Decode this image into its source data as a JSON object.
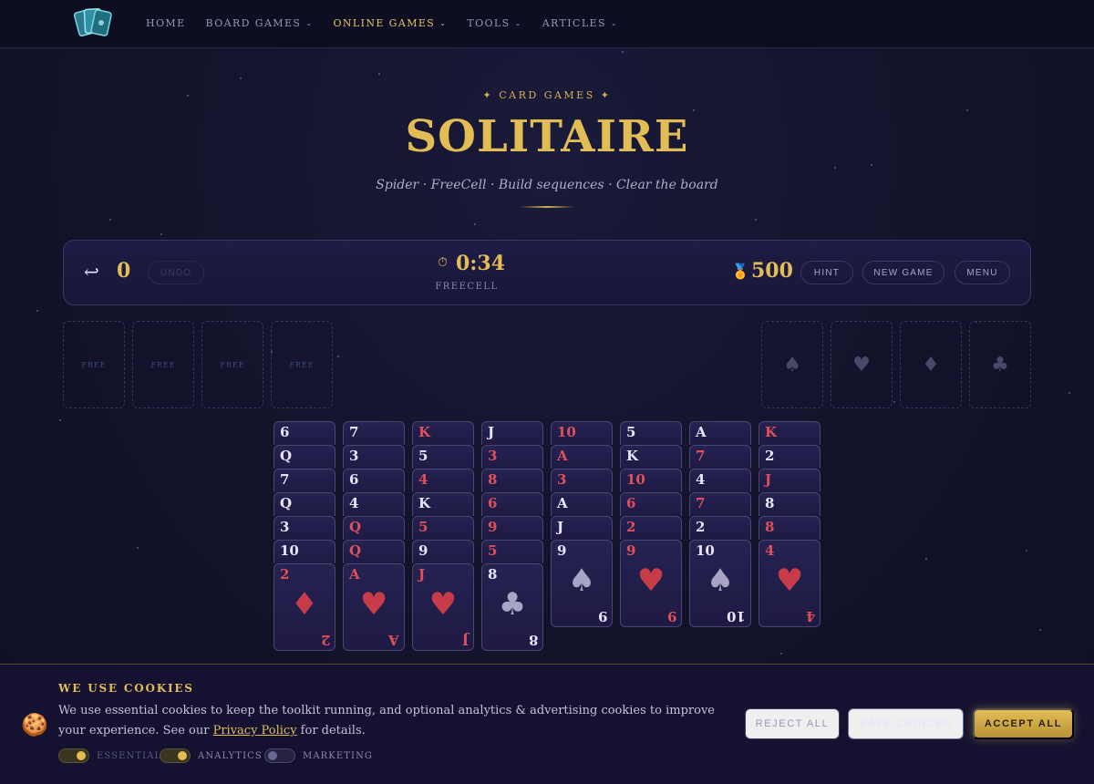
{
  "nav": {
    "items": [
      {
        "label": "HOME",
        "dropdown": false,
        "active": false
      },
      {
        "label": "BOARD GAMES",
        "dropdown": true,
        "active": false
      },
      {
        "label": "ONLINE GAMES",
        "dropdown": true,
        "active": true
      },
      {
        "label": "TOOLS",
        "dropdown": true,
        "active": false
      },
      {
        "label": "ARTICLES",
        "dropdown": true,
        "active": false
      }
    ]
  },
  "hero": {
    "kicker": "✦ CARD GAMES ✦",
    "title": "SOLITAIRE",
    "subtitle": "Spider · FreeCell · Build sequences · Clear the board"
  },
  "status": {
    "moves": "0",
    "undo_label": "UNDO",
    "timer": "0:34",
    "mode": "FREECELL",
    "score": "500",
    "hint_label": "HINT",
    "new_game_label": "NEW GAME",
    "menu_label": "MENU"
  },
  "free_cells": [
    "FREE",
    "FREE",
    "FREE",
    "FREE"
  ],
  "foundations": [
    {
      "suit": "♠",
      "icon": "spade-icon"
    },
    {
      "suit": "♥",
      "icon": "heart-icon"
    },
    {
      "suit": "♦",
      "icon": "diamond-icon"
    },
    {
      "suit": "♣",
      "icon": "club-icon"
    }
  ],
  "tableau": [
    {
      "cards": [
        {
          "r": "6",
          "c": "blk"
        },
        {
          "r": "Q",
          "c": "blk"
        },
        {
          "r": "7",
          "c": "blk"
        },
        {
          "r": "Q",
          "c": "blk"
        },
        {
          "r": "3",
          "c": "blk"
        },
        {
          "r": "10",
          "c": "blk"
        },
        {
          "r": "2",
          "c": "red",
          "suit": "♦"
        }
      ]
    },
    {
      "cards": [
        {
          "r": "7",
          "c": "blk"
        },
        {
          "r": "3",
          "c": "blk"
        },
        {
          "r": "6",
          "c": "blk"
        },
        {
          "r": "4",
          "c": "blk"
        },
        {
          "r": "Q",
          "c": "red"
        },
        {
          "r": "Q",
          "c": "red"
        },
        {
          "r": "A",
          "c": "red",
          "suit": "♥"
        }
      ]
    },
    {
      "cards": [
        {
          "r": "K",
          "c": "red"
        },
        {
          "r": "5",
          "c": "blk"
        },
        {
          "r": "4",
          "c": "red"
        },
        {
          "r": "K",
          "c": "blk"
        },
        {
          "r": "5",
          "c": "red"
        },
        {
          "r": "9",
          "c": "blk"
        },
        {
          "r": "J",
          "c": "red",
          "suit": "♥"
        }
      ]
    },
    {
      "cards": [
        {
          "r": "J",
          "c": "blk"
        },
        {
          "r": "3",
          "c": "red"
        },
        {
          "r": "8",
          "c": "red"
        },
        {
          "r": "6",
          "c": "red"
        },
        {
          "r": "9",
          "c": "red"
        },
        {
          "r": "5",
          "c": "red"
        },
        {
          "r": "8",
          "c": "blk",
          "suit": "♣"
        }
      ]
    },
    {
      "cards": [
        {
          "r": "10",
          "c": "red"
        },
        {
          "r": "A",
          "c": "red"
        },
        {
          "r": "3",
          "c": "red"
        },
        {
          "r": "A",
          "c": "blk"
        },
        {
          "r": "J",
          "c": "blk"
        },
        {
          "r": "9",
          "c": "blk",
          "suit": "♠"
        }
      ]
    },
    {
      "cards": [
        {
          "r": "5",
          "c": "blk"
        },
        {
          "r": "K",
          "c": "blk"
        },
        {
          "r": "10",
          "c": "red"
        },
        {
          "r": "6",
          "c": "red"
        },
        {
          "r": "2",
          "c": "red"
        },
        {
          "r": "9",
          "c": "red",
          "suit": "♥"
        }
      ]
    },
    {
      "cards": [
        {
          "r": "A",
          "c": "blk"
        },
        {
          "r": "7",
          "c": "red"
        },
        {
          "r": "4",
          "c": "blk"
        },
        {
          "r": "7",
          "c": "red"
        },
        {
          "r": "2",
          "c": "blk"
        },
        {
          "r": "10",
          "c": "blk",
          "suit": "♠"
        }
      ]
    },
    {
      "cards": [
        {
          "r": "K",
          "c": "red"
        },
        {
          "r": "2",
          "c": "blk"
        },
        {
          "r": "J",
          "c": "red"
        },
        {
          "r": "8",
          "c": "blk"
        },
        {
          "r": "8",
          "c": "red"
        },
        {
          "r": "4",
          "c": "red",
          "suit": "♥"
        }
      ]
    }
  ],
  "cookie": {
    "title": "WE USE COOKIES",
    "text_before": "We use essential cookies to keep the toolkit running, and optional analytics & advertising cookies to improve your experience. See our ",
    "link": "Privacy Policy",
    "text_after": " for details.",
    "toggles": [
      {
        "label": "ESSENTIAL",
        "on": true
      },
      {
        "label": "ANALYTICS",
        "on": true
      },
      {
        "label": "MARKETING",
        "on": false
      }
    ],
    "reject_label": "REJECT ALL",
    "save_label": "SAVE CHOICES",
    "accept_label": "ACCEPT ALL"
  }
}
